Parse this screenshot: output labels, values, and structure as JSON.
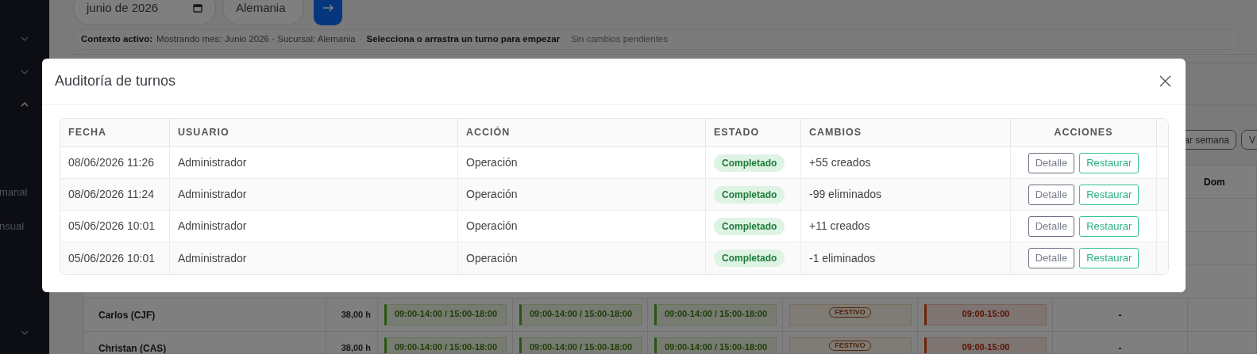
{
  "sidebar": {
    "items": [
      {
        "expanded": false
      },
      {
        "expanded": false
      },
      {
        "expanded": true,
        "children": [
          {
            "label": "manal"
          },
          {
            "label": "nsual"
          }
        ]
      },
      {
        "expanded": false
      }
    ]
  },
  "filters": {
    "date": "junio de 2026",
    "branch": "Alemania"
  },
  "context_bar": {
    "label": "Contexto activo:",
    "text": "Mostrando mes: Junio 2026 · Sucursal: Alemania",
    "separator_1": "·",
    "hint": "Selecciona o arrastra un turno para empezar",
    "separator_2": "·",
    "status": "Sin cambios pendientes"
  },
  "toolbar": {
    "buttons": [
      "ar semana",
      "V"
    ]
  },
  "schedule": {
    "columns": [
      "Dom"
    ],
    "rows": [
      {
        "name": "Carlos (CJF)",
        "hours": "38,00 h",
        "cells": [
          {
            "kind": "shift",
            "text": "09:00-14:00 / 15:00-18:00"
          },
          {
            "kind": "shift",
            "text": "09:00-14:00 / 15:00-18:00"
          },
          {
            "kind": "shift",
            "text": "09:00-14:00 / 15:00-18:00"
          },
          {
            "kind": "holiday",
            "text": "FESTIVO"
          },
          {
            "kind": "alert",
            "text": "09:00-15:00"
          },
          {
            "kind": "empty",
            "text": "-"
          }
        ]
      },
      {
        "name": "Christan (CAS)",
        "hours": "38,00 h",
        "cells": [
          {
            "kind": "shift",
            "text": "09:00-14:00 / 15:00-18:00"
          },
          {
            "kind": "shift",
            "text": "09:00-14:00 / 15:00-18:00"
          },
          {
            "kind": "shift",
            "text": "09:00-14:00 / 15:00-18:00"
          },
          {
            "kind": "holiday",
            "text": "FESTIVO"
          },
          {
            "kind": "alert",
            "text": "09:00-15:00"
          },
          {
            "kind": "empty",
            "text": "-"
          }
        ]
      }
    ]
  },
  "modal": {
    "title": "Auditoría de turnos",
    "table": {
      "columns": [
        "FECHA",
        "USUARIO",
        "ACCIÓN",
        "ESTADO",
        "CAMBIOS",
        "ACCIONES"
      ],
      "rows": [
        {
          "date": "08/06/2026 11:26",
          "user": "Administrador",
          "action": "Operación",
          "status": {
            "label": "Completado",
            "kind": "success"
          },
          "changes": "+55 creados",
          "buttons": [
            "Detalle",
            "Restaurar"
          ]
        },
        {
          "date": "08/06/2026 11:24",
          "user": "Administrador",
          "action": "Operación",
          "status": {
            "label": "Completado",
            "kind": "success"
          },
          "changes": "-99 eliminados",
          "buttons": [
            "Detalle",
            "Restaurar"
          ]
        },
        {
          "date": "05/06/2026 10:01",
          "user": "Administrador",
          "action": "Operación",
          "status": {
            "label": "Completado",
            "kind": "success"
          },
          "changes": "+11 creados",
          "buttons": [
            "Detalle",
            "Restaurar"
          ]
        },
        {
          "date": "05/06/2026 10:01",
          "user": "Administrador",
          "action": "Operación",
          "status": {
            "label": "Completado",
            "kind": "success"
          },
          "changes": "-1 eliminados",
          "buttons": [
            "Detalle",
            "Restaurar"
          ]
        }
      ]
    }
  }
}
